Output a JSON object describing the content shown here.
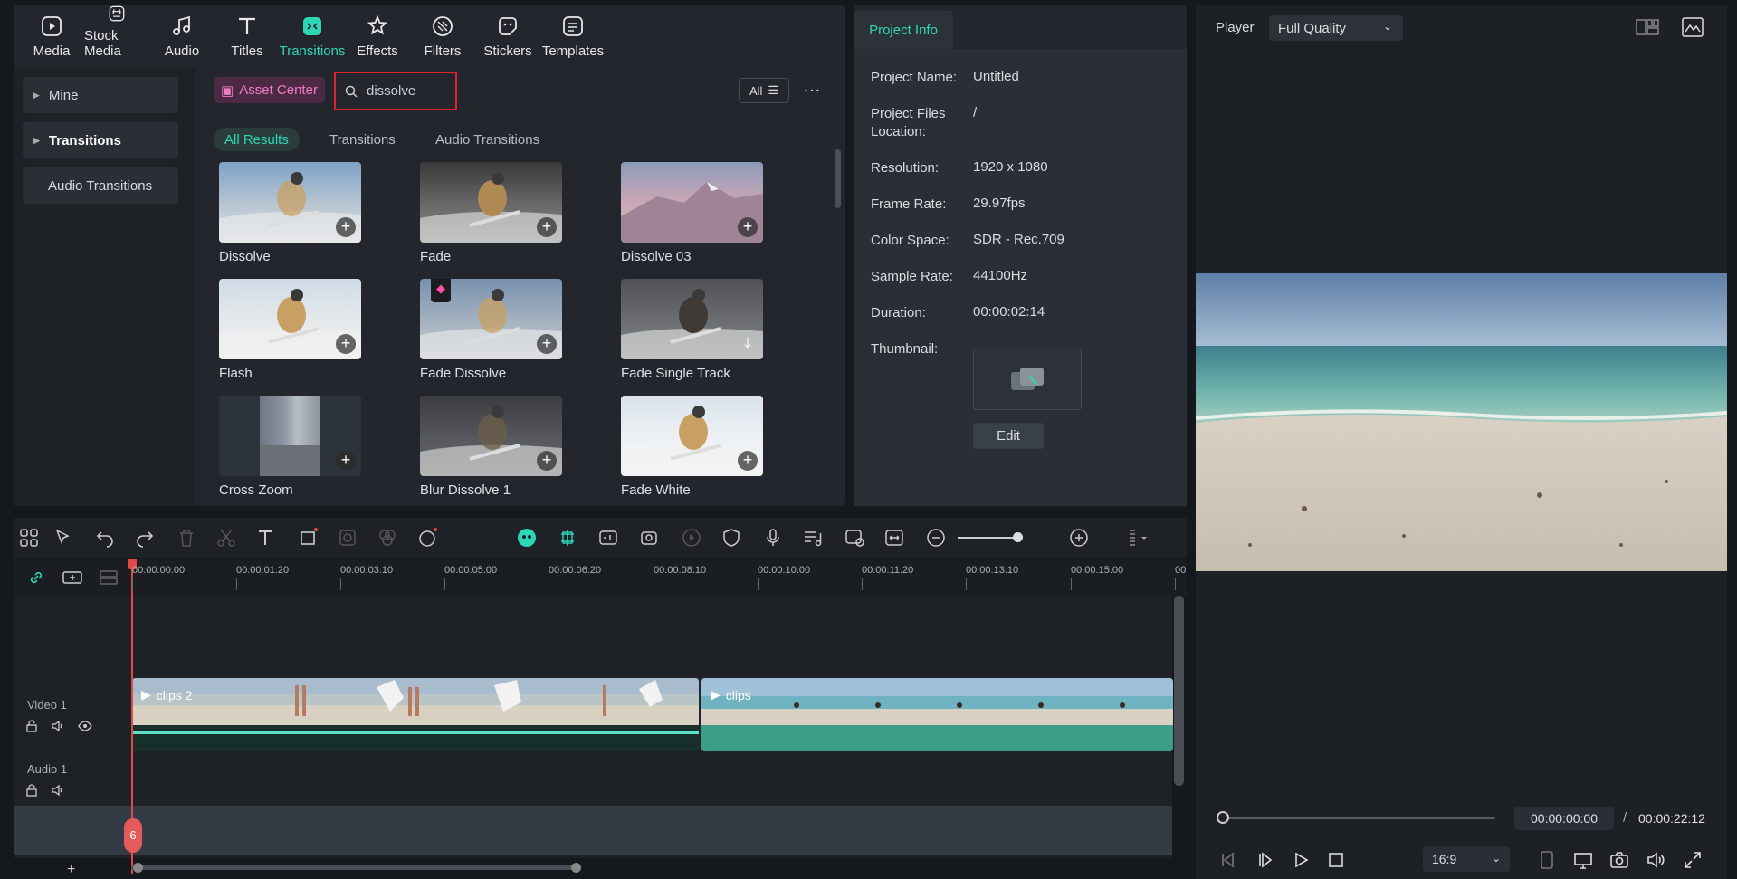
{
  "toolbar": {
    "tabs": [
      {
        "label": "Media",
        "icon": "media-icon"
      },
      {
        "label": "Stock Media",
        "icon": "stock-media-icon"
      },
      {
        "label": "Audio",
        "icon": "audio-icon"
      },
      {
        "label": "Titles",
        "icon": "titles-icon"
      },
      {
        "label": "Transitions",
        "icon": "transitions-icon",
        "active": true
      },
      {
        "label": "Effects",
        "icon": "effects-icon"
      },
      {
        "label": "Filters",
        "icon": "filters-icon"
      },
      {
        "label": "Stickers",
        "icon": "stickers-icon"
      },
      {
        "label": "Templates",
        "icon": "templates-icon"
      }
    ],
    "accent": "#2ed6b8"
  },
  "sidebar": {
    "items": [
      {
        "label": "Mine"
      },
      {
        "label": "Transitions"
      },
      {
        "label": "Audio Transitions"
      }
    ]
  },
  "search": {
    "asset_center": "Asset Center",
    "query": "dissolve",
    "filter": "All"
  },
  "result_tabs": [
    "All Results",
    "Transitions",
    "Audio Transitions"
  ],
  "results": [
    {
      "label": "Dissolve",
      "action": "add"
    },
    {
      "label": "Fade",
      "action": "add"
    },
    {
      "label": "Dissolve 03",
      "action": "add"
    },
    {
      "label": "Flash",
      "action": "add"
    },
    {
      "label": "Fade Dissolve",
      "action": "add",
      "premium": true
    },
    {
      "label": "Fade Single Track",
      "action": "download"
    },
    {
      "label": "Cross Zoom",
      "action": "add"
    },
    {
      "label": "Blur Dissolve 1",
      "action": "add"
    },
    {
      "label": "Fade White",
      "action": "add"
    }
  ],
  "project_info": {
    "tab": "Project Info",
    "fields": [
      {
        "label": "Project Name:",
        "value": "Untitled"
      },
      {
        "label": "Project Files Location:",
        "value": "/"
      },
      {
        "label": "Resolution:",
        "value": "1920 x 1080"
      },
      {
        "label": "Frame Rate:",
        "value": "29.97fps"
      },
      {
        "label": "Color Space:",
        "value": "SDR - Rec.709"
      },
      {
        "label": "Sample Rate:",
        "value": "44100Hz"
      },
      {
        "label": "Duration:",
        "value": "00:00:02:14"
      },
      {
        "label": "Thumbnail:",
        "value": ""
      }
    ],
    "edit": "Edit"
  },
  "player": {
    "label": "Player",
    "quality": "Full Quality",
    "current_time": "00:00:00:00",
    "separator": "/",
    "total_time": "00:00:22:12",
    "ratio": "16:9",
    "progress": 0
  },
  "timeline": {
    "ruler": [
      "00:00:00:00",
      "00:00:01:20",
      "00:00:03:10",
      "00:00:05:00",
      "00:00:06:20",
      "00:00:08:10",
      "00:00:10:00",
      "00:00:11:20",
      "00:00:13:10",
      "00:00:15:00",
      "00"
    ],
    "tracks": [
      {
        "name": "Video 1"
      },
      {
        "name": "Audio 1"
      }
    ],
    "clips": [
      {
        "label": "clips 2"
      },
      {
        "label": "clips"
      }
    ],
    "playhead_marker": "6",
    "add_track": "+"
  }
}
